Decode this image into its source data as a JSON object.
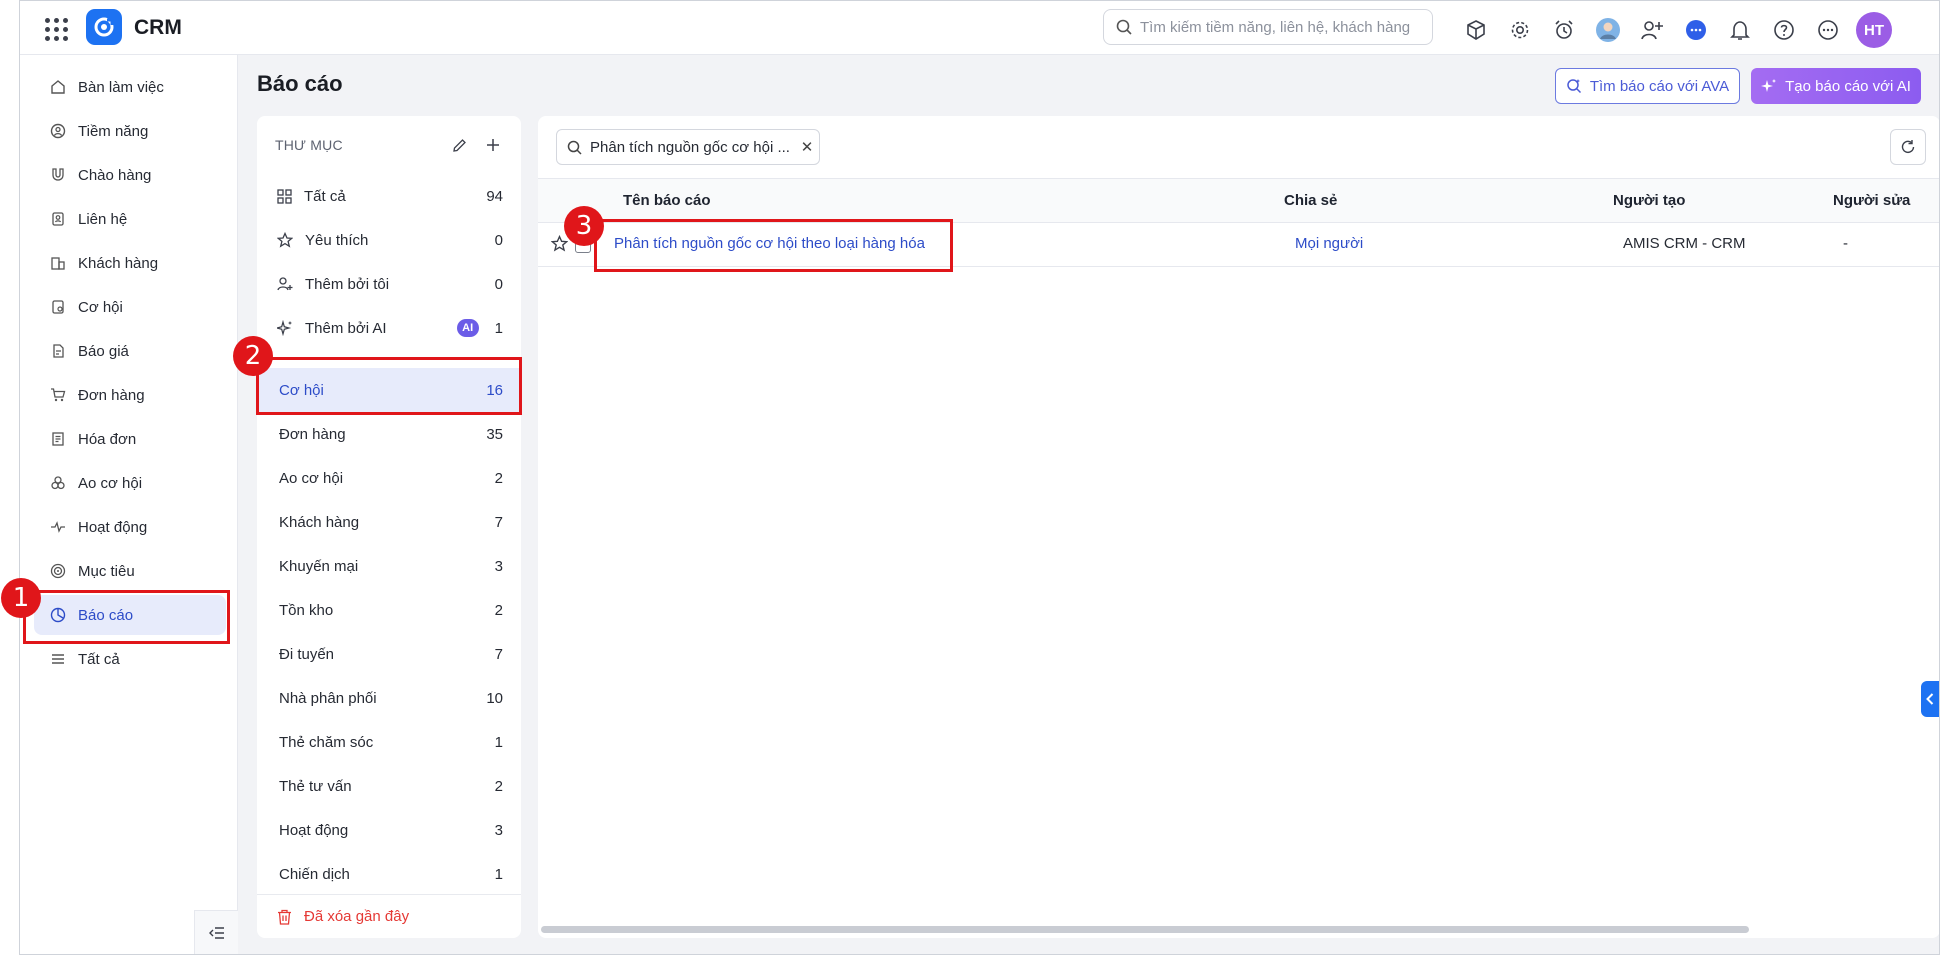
{
  "app": {
    "title": "CRM"
  },
  "search": {
    "placeholder": "Tìm kiếm tiềm năng, liên hệ, khách hàng"
  },
  "user": {
    "initials": "HT"
  },
  "nav": {
    "items": [
      {
        "label": "Bàn làm việc",
        "icon": "home-icon"
      },
      {
        "label": "Tiềm năng",
        "icon": "lead-icon"
      },
      {
        "label": "Chào hàng",
        "icon": "magnet-icon"
      },
      {
        "label": "Liên hệ",
        "icon": "contact-icon"
      },
      {
        "label": "Khách hàng",
        "icon": "building-icon"
      },
      {
        "label": "Cơ hội",
        "icon": "opportunity-icon"
      },
      {
        "label": "Báo giá",
        "icon": "quote-icon"
      },
      {
        "label": "Đơn hàng",
        "icon": "cart-icon"
      },
      {
        "label": "Hóa đơn",
        "icon": "invoice-icon"
      },
      {
        "label": "Ao cơ hội",
        "icon": "pool-icon"
      },
      {
        "label": "Hoạt động",
        "icon": "activity-icon"
      },
      {
        "label": "Mục tiêu",
        "icon": "target-icon"
      },
      {
        "label": "Báo cáo",
        "icon": "report-icon",
        "active": true
      },
      {
        "label": "Tất cả",
        "icon": "list-icon"
      }
    ]
  },
  "page": {
    "title": "Báo cáo",
    "ava_button": "Tìm báo cáo với AVA",
    "ai_button": "Tạo báo cáo với AI"
  },
  "folders": {
    "header": "THƯ MỤC",
    "fixed": [
      {
        "label": "Tất cả",
        "count": "94",
        "icon": "grid-icon"
      },
      {
        "label": "Yêu thích",
        "count": "0",
        "icon": "star-icon"
      },
      {
        "label": "Thêm bởi tôi",
        "count": "0",
        "icon": "user-add-icon"
      },
      {
        "label": "Thêm bởi AI",
        "count": "1",
        "icon": "sparkle-icon",
        "badge": "AI"
      }
    ],
    "groups": [
      {
        "label": "Cơ hội",
        "count": "16",
        "active": true
      },
      {
        "label": "Đơn hàng",
        "count": "35"
      },
      {
        "label": "Ao cơ hội",
        "count": "2"
      },
      {
        "label": "Khách hàng",
        "count": "7"
      },
      {
        "label": "Khuyến mại",
        "count": "3"
      },
      {
        "label": "Tồn kho",
        "count": "2"
      },
      {
        "label": "Đi tuyến",
        "count": "7"
      },
      {
        "label": "Nhà phân phối",
        "count": "10"
      },
      {
        "label": "Thẻ chăm sóc",
        "count": "1"
      },
      {
        "label": "Thẻ tư vấn",
        "count": "2"
      },
      {
        "label": "Hoạt động",
        "count": "3"
      },
      {
        "label": "Chiến dịch",
        "count": "1"
      }
    ],
    "deleted": "Đã xóa gần đây"
  },
  "reports": {
    "filter_chip": "Phân tích nguồn gốc cơ hội ...",
    "columns": {
      "name": "Tên báo cáo",
      "share": "Chia sẻ",
      "creator": "Người tạo",
      "editor": "Người sửa"
    },
    "rows": [
      {
        "name": "Phân tích nguồn gốc cơ hội theo loại hàng hóa",
        "share": "Mọi người",
        "creator": "AMIS CRM - CRM",
        "editor": "-"
      }
    ]
  },
  "annotations": {
    "m1": "1",
    "m2": "2",
    "m3": "3"
  },
  "colors": {
    "accent": "#2d4cc8",
    "brand": "#1d72f2",
    "highlight": "#e0161a",
    "ai_purple": "#9b5de5"
  }
}
